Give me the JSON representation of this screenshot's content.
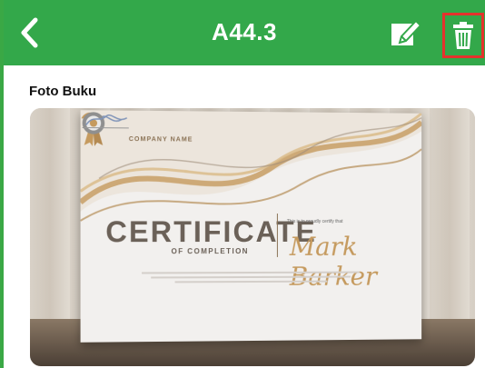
{
  "header": {
    "title": "A44.3",
    "back_icon": "chevron-left-icon",
    "edit_icon": "edit-icon",
    "delete_icon": "trash-icon",
    "bar_color": "#33a84a",
    "highlight_color": "#e5322d"
  },
  "content": {
    "section_label": "Foto Buku"
  },
  "certificate": {
    "company": "COMPANY NAME",
    "title": "CERTIFICATE",
    "subtitle": "OF COMPLETION",
    "presented": "This is to proudly certify that",
    "recipient": "Mark Barker"
  }
}
